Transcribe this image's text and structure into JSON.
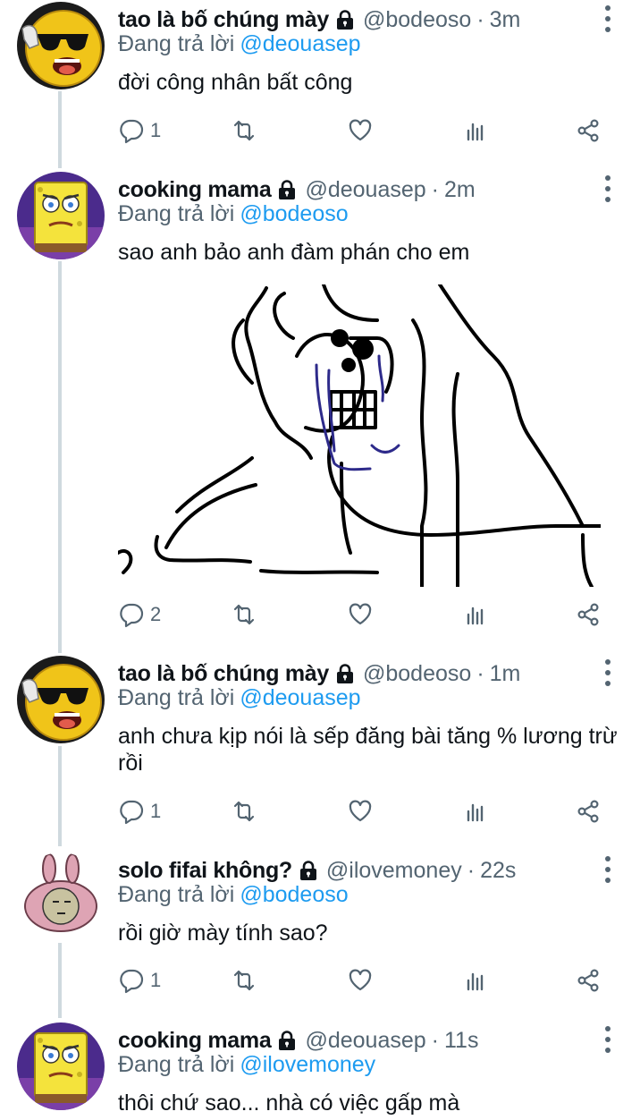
{
  "reply_prefix": "Đang trả lời",
  "tweets": [
    {
      "name": "tao là bố chúng mày",
      "handle": "@bodeoso",
      "separator": "·",
      "time": "3m",
      "reply_to": "@deouasep",
      "text": "đời công nhân bất công",
      "reply_count": "1",
      "avatar_icon": "sunglasses-emoji-avatar"
    },
    {
      "name": "cooking mama",
      "handle": "@deouasep",
      "separator": "·",
      "time": "2m",
      "reply_to": "@bodeoso",
      "text": "sao anh bảo anh đàm phán cho em",
      "reply_count": "2",
      "has_media": true,
      "media_icon": "crying-drawing-image",
      "avatar_icon": "spongebob-avatar"
    },
    {
      "name": "tao là bố chúng mày",
      "handle": "@bodeoso",
      "separator": "·",
      "time": "1m",
      "reply_to": "@deouasep",
      "text": "anh chưa kịp nói là sếp đăng bài tăng % lương trừ rồi",
      "reply_count": "1",
      "avatar_icon": "sunglasses-emoji-avatar"
    },
    {
      "name": "solo fifai không?",
      "handle": "@ilovemoney",
      "separator": "·",
      "time": "22s",
      "reply_to": "@bodeoso",
      "text": "rồi giờ mày tính sao?",
      "reply_count": "1",
      "avatar_icon": "pink-bunny-avatar"
    },
    {
      "name": "cooking mama",
      "handle": "@deouasep",
      "separator": "·",
      "time": "11s",
      "reply_to": "@ilovemoney",
      "text": "thôi chứ sao... nhà có việc gấp mà",
      "avatar_icon": "spongebob-avatar"
    }
  ],
  "colors": {
    "link": "#1d9bf0",
    "muted": "#536471",
    "line": "#cfd9de"
  }
}
